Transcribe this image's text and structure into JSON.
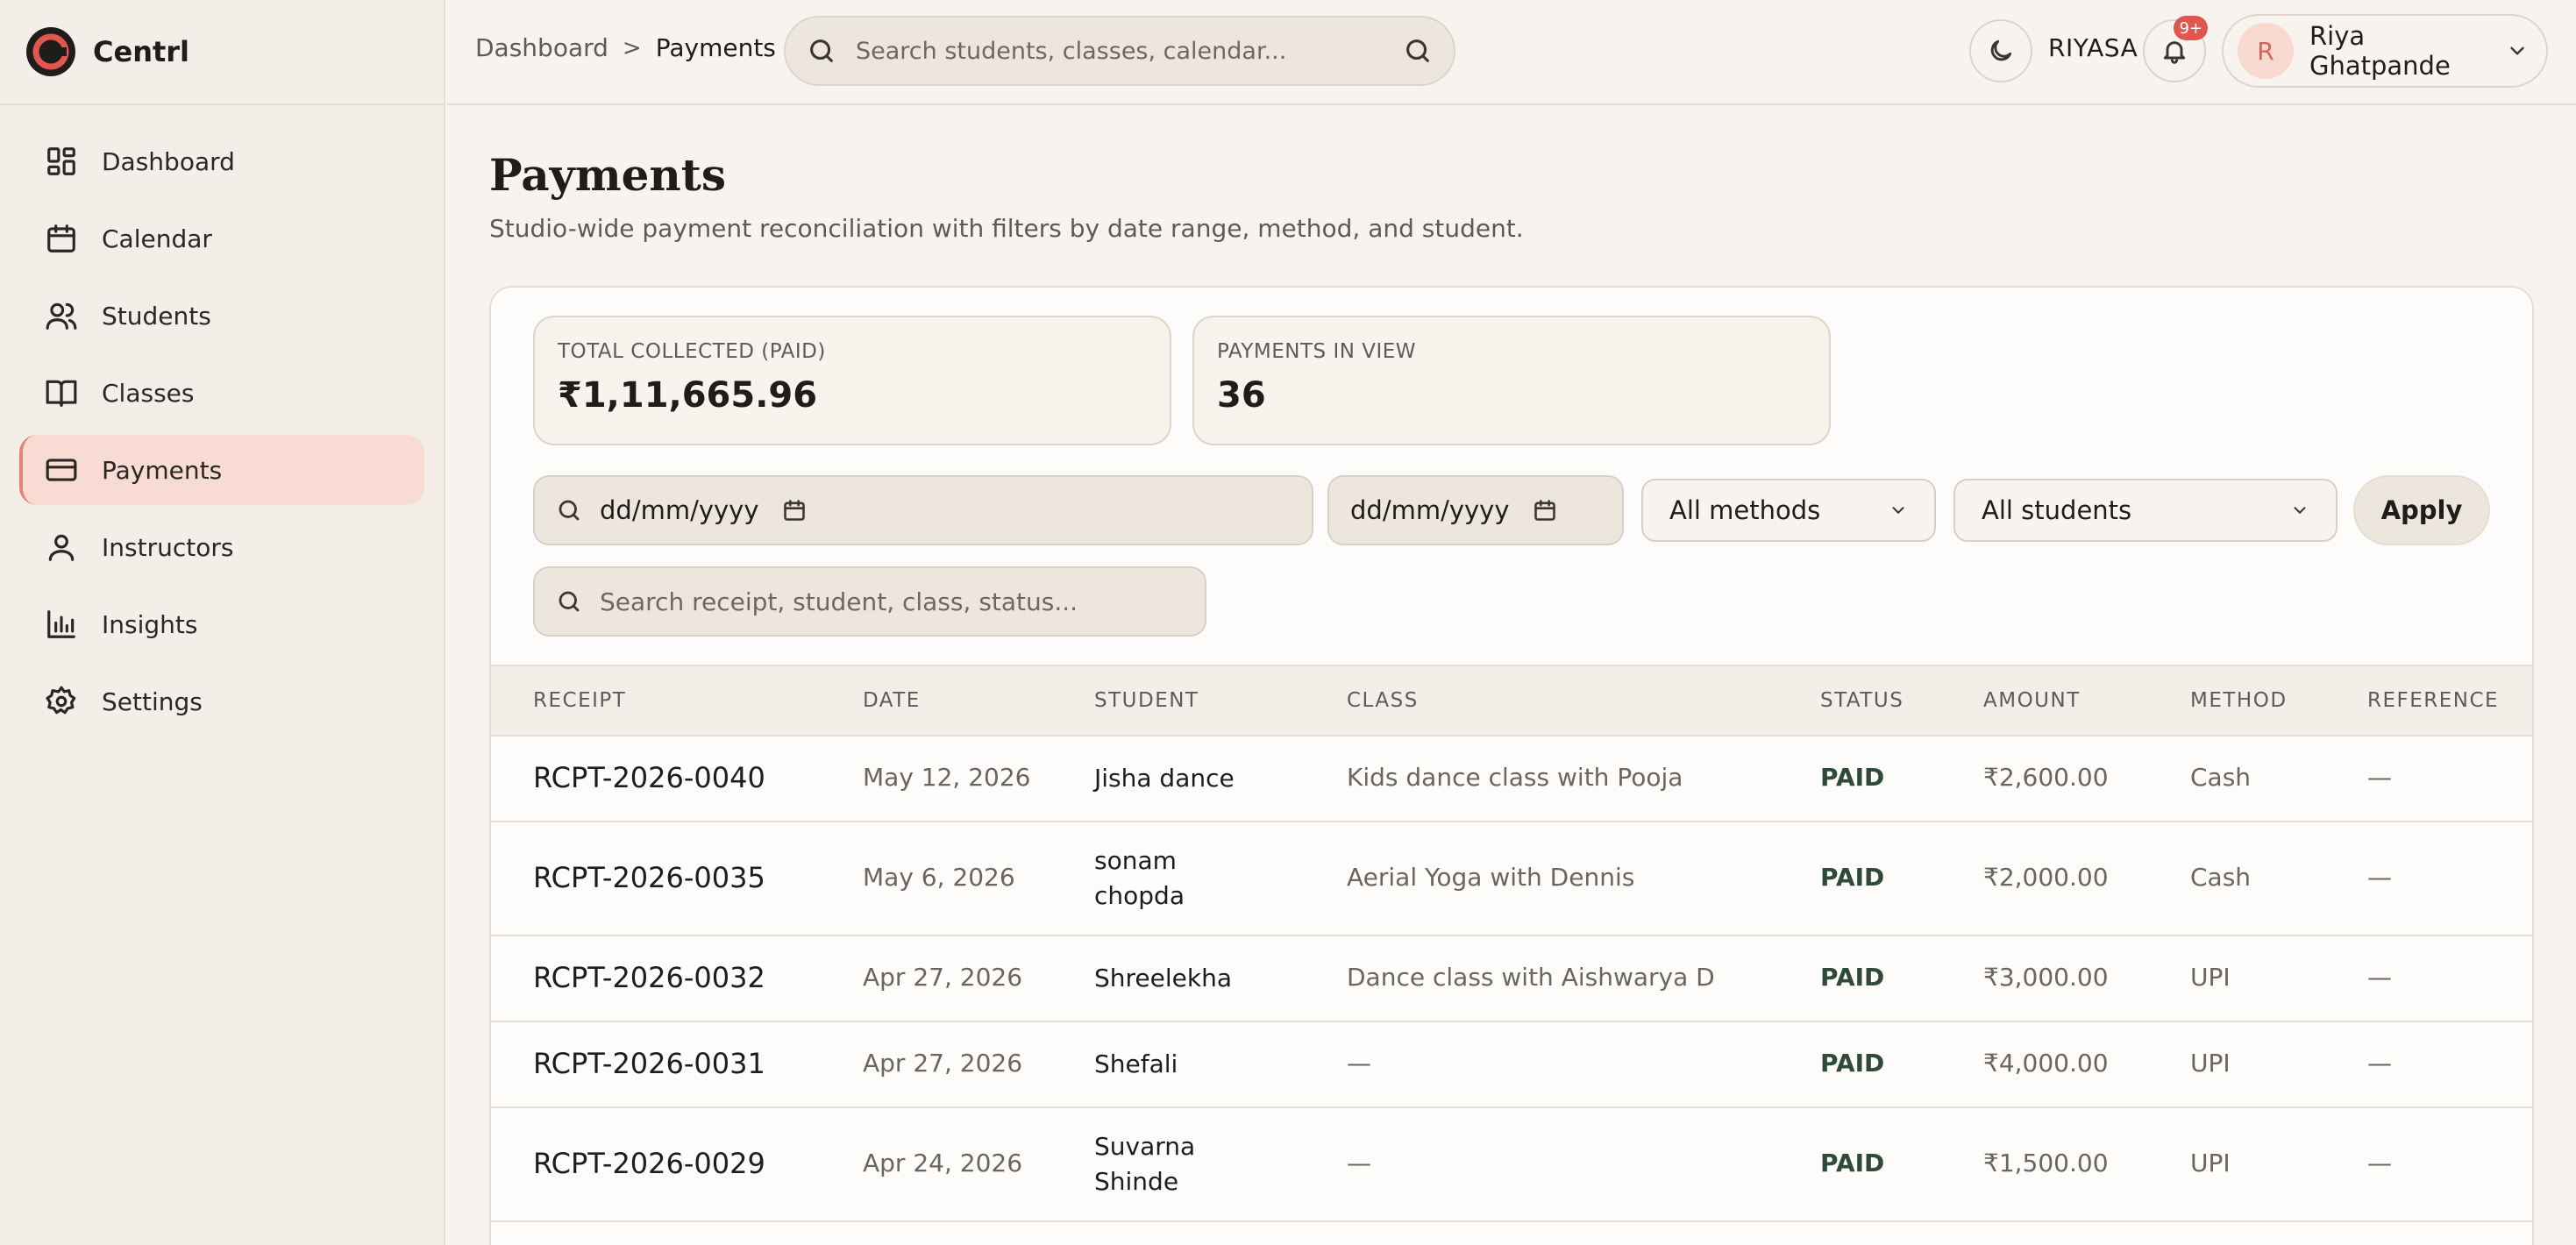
{
  "brand": {
    "name": "Centrl"
  },
  "sidebar": {
    "items": [
      {
        "label": "Dashboard",
        "icon": "grid-icon"
      },
      {
        "label": "Calendar",
        "icon": "calendar-icon"
      },
      {
        "label": "Students",
        "icon": "users-icon"
      },
      {
        "label": "Classes",
        "icon": "book-icon"
      },
      {
        "label": "Payments",
        "icon": "credit-card-icon",
        "active": true
      },
      {
        "label": "Instructors",
        "icon": "user-icon"
      },
      {
        "label": "Insights",
        "icon": "bar-chart-icon"
      },
      {
        "label": "Settings",
        "icon": "gear-icon"
      }
    ]
  },
  "header": {
    "breadcrumb": {
      "parent": "Dashboard",
      "separator": ">",
      "current": "Payments"
    },
    "search_placeholder": "Search students, classes, calendar...",
    "org_label": "RIYASA",
    "notifications_badge": "9+",
    "user": {
      "initial": "R",
      "name": "Riya Ghatpande"
    }
  },
  "page": {
    "title": "Payments",
    "subtitle": "Studio-wide payment reconciliation with filters by date range, method, and student."
  },
  "stats": {
    "total_label": "TOTAL COLLECTED (PAID)",
    "total_value": "₹1,11,665.96",
    "count_label": "PAYMENTS IN VIEW",
    "count_value": "36"
  },
  "filters": {
    "date_from": "dd/mm/yyyy",
    "date_to": "dd/mm/yyyy",
    "method": "All methods",
    "student": "All students",
    "apply_label": "Apply",
    "search_placeholder": "Search receipt, student, class, status..."
  },
  "table": {
    "headers": [
      "RECEIPT",
      "DATE",
      "STUDENT",
      "CLASS",
      "STATUS",
      "AMOUNT",
      "METHOD",
      "REFERENCE"
    ],
    "rows": [
      {
        "receipt": "RCPT-2026-0040",
        "date": "May 12, 2026",
        "student_1": "Jisha dance",
        "student_2": "",
        "class": "Kids dance class with Pooja",
        "status": "PAID",
        "amount": "₹2,600.00",
        "method": "Cash",
        "reference": "—"
      },
      {
        "receipt": "RCPT-2026-0035",
        "date": "May 6, 2026",
        "student_1": "sonam",
        "student_2": "chopda",
        "class": "Aerial Yoga with Dennis",
        "status": "PAID",
        "amount": "₹2,000.00",
        "method": "Cash",
        "reference": "—"
      },
      {
        "receipt": "RCPT-2026-0032",
        "date": "Apr 27, 2026",
        "student_1": "Shreelekha",
        "student_2": "",
        "class": "Dance class with Aishwarya D",
        "status": "PAID",
        "amount": "₹3,000.00",
        "method": "UPI",
        "reference": "—"
      },
      {
        "receipt": "RCPT-2026-0031",
        "date": "Apr 27, 2026",
        "student_1": "Shefali",
        "student_2": "",
        "class": "—",
        "status": "PAID",
        "amount": "₹4,000.00",
        "method": "UPI",
        "reference": "—"
      },
      {
        "receipt": "RCPT-2026-0029",
        "date": "Apr 24, 2026",
        "student_1": "Suvarna",
        "student_2": "Shinde",
        "class": "—",
        "status": "PAID",
        "amount": "₹1,500.00",
        "method": "UPI",
        "reference": "—"
      }
    ]
  }
}
